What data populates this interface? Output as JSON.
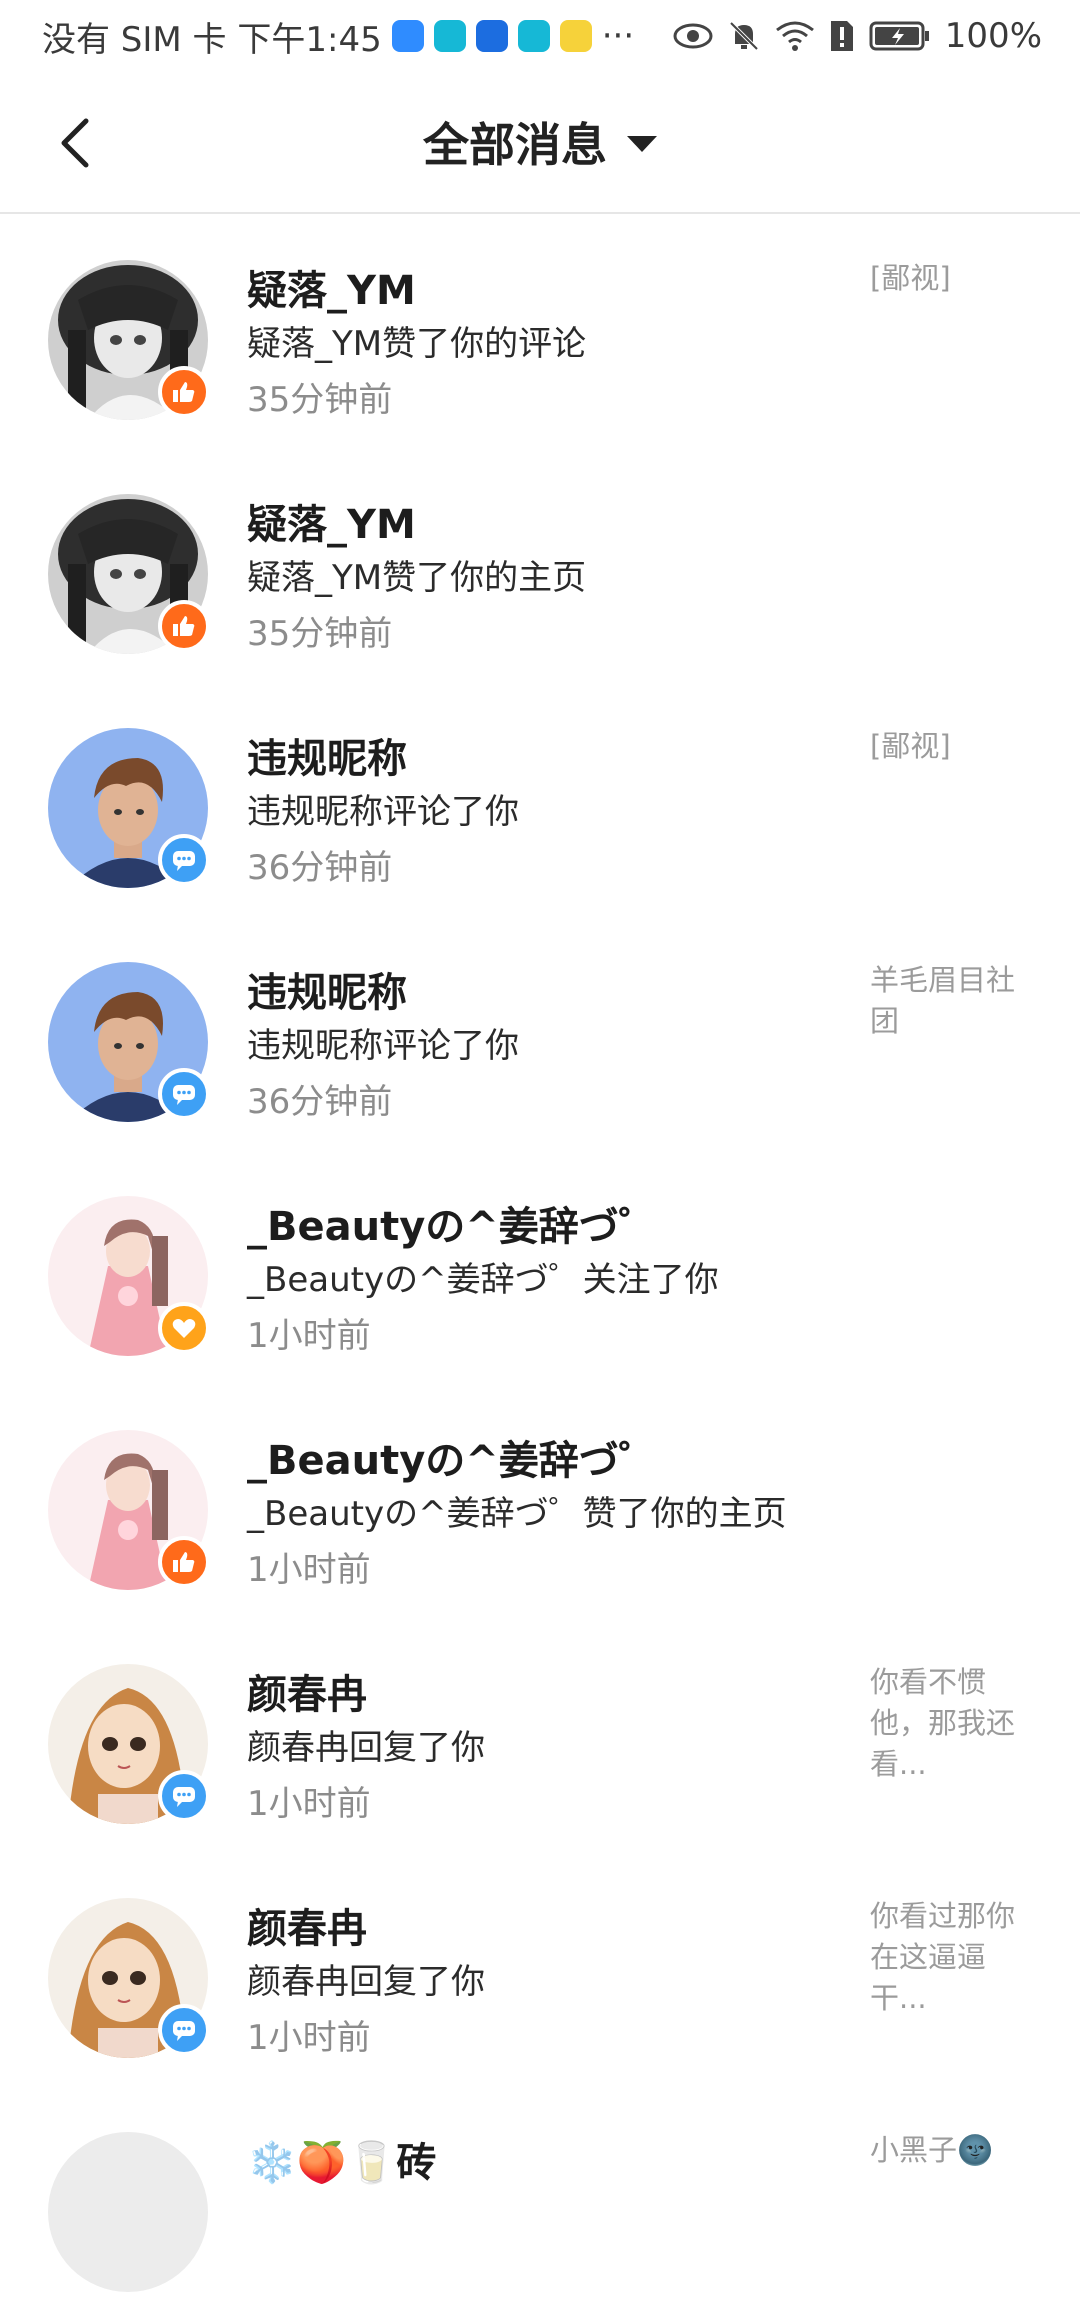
{
  "status_bar": {
    "carrier_time": "没有 SIM 卡 下午1:45",
    "more": "···",
    "battery": "100%"
  },
  "header": {
    "title": "全部消息"
  },
  "messages": [
    {
      "name": "疑落_YM",
      "action": "疑落_YM赞了你的评论",
      "time": "35分钟前",
      "preview": "[鄙视]",
      "type": "like"
    },
    {
      "name": "疑落_YM",
      "action": "疑落_YM赞了你的主页",
      "time": "35分钟前",
      "preview": "",
      "type": "like"
    },
    {
      "name": "违规昵称",
      "action": "违规昵称评论了你",
      "time": "36分钟前",
      "preview": "[鄙视]",
      "type": "comment"
    },
    {
      "name": "违规昵称",
      "action": "违规昵称评论了你",
      "time": "36分钟前",
      "preview": "羊毛眉目社团",
      "type": "comment"
    },
    {
      "name": "_Beautyの^姜辞づ゜",
      "action": "_Beautyの^姜辞づ゜关注了你",
      "time": "1小时前",
      "preview": "",
      "type": "follow"
    },
    {
      "name": "_Beautyの^姜辞づ゜",
      "action": "_Beautyの^姜辞づ゜赞了你的主页",
      "time": "1小时前",
      "preview": "",
      "type": "like"
    },
    {
      "name": "颜春冉",
      "action": "颜春冉回复了你",
      "time": "1小时前",
      "preview": "你看不惯他，那我还看...",
      "type": "comment"
    },
    {
      "name": "颜春冉",
      "action": "颜春冉回复了你",
      "time": "1小时前",
      "preview": "你看过那你在这逼逼干...",
      "type": "comment"
    },
    {
      "name": "❄️🍑🥛砖",
      "action": "",
      "time": "",
      "preview": "小黑子🌚",
      "type": "comment"
    }
  ],
  "colors": {
    "like": "#ff6a1a",
    "comment": "#3ea0f5",
    "follow": "#ffa31a"
  }
}
